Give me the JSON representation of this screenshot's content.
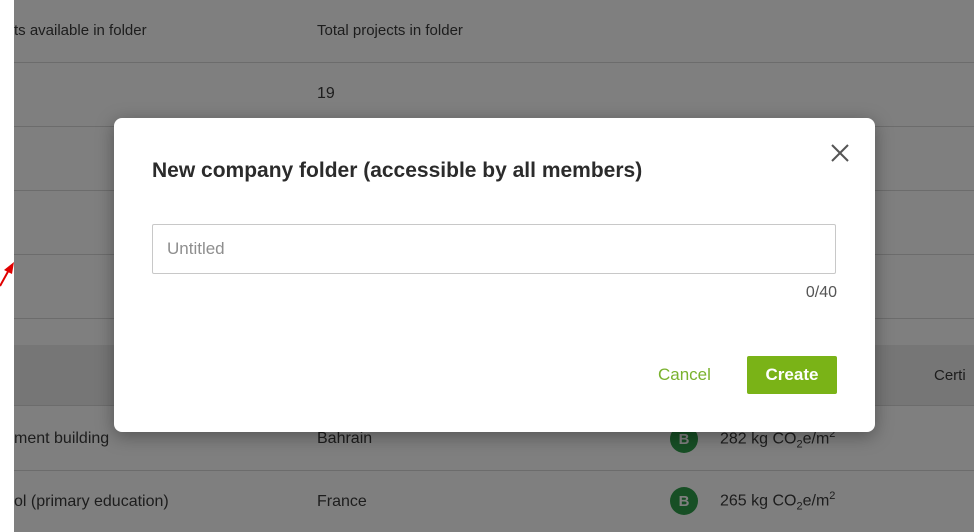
{
  "table": {
    "header": {
      "col_available": "ts available in folder",
      "col_total": "Total projects in folder"
    },
    "rows": [
      {
        "total": "19"
      }
    ],
    "section_header": {
      "cert_fragment": "Certi"
    },
    "projects": [
      {
        "name": "ment building",
        "country": "Bahrain",
        "badge": "B",
        "value": "282 kg CO",
        "sub": "2",
        "unit": "e/m",
        "sup": "2"
      },
      {
        "name": "ol (primary education)",
        "country": "France",
        "badge": "B",
        "value": "265 kg CO",
        "sub": "2",
        "unit": "e/m",
        "sup": "2"
      }
    ]
  },
  "modal": {
    "title": "New company folder (accessible by all members)",
    "input_placeholder": "Untitled",
    "input_value": "",
    "counter": "0/40",
    "cancel_label": "Cancel",
    "create_label": "Create"
  },
  "icons": {
    "close": "close-icon",
    "annotation": "red-arrow-icon"
  },
  "colors": {
    "accent": "#7ab317",
    "badge_green": "#2e9e4a",
    "annotation_red": "#e00000"
  }
}
